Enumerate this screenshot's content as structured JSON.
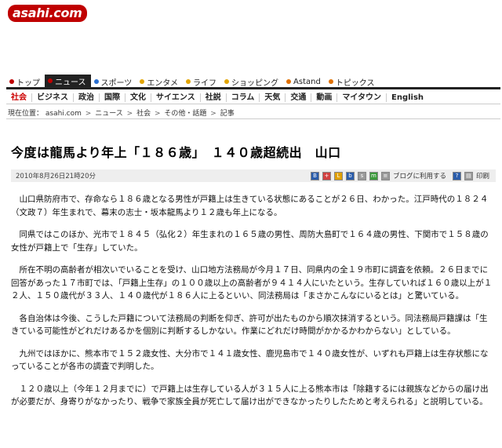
{
  "brand": {
    "logo": "asahi.com"
  },
  "nav_primary": [
    {
      "label": "トップ",
      "color": "#c00000"
    },
    {
      "label": "ニュース",
      "color": "#c00000",
      "active": true
    },
    {
      "label": "スポーツ",
      "color": "#2a6fd1"
    },
    {
      "label": "エンタメ",
      "color": "#e2a400"
    },
    {
      "label": "ライフ",
      "color": "#e2a400"
    },
    {
      "label": "ショッピング",
      "color": "#e2a400"
    },
    {
      "label": "Astand",
      "color": "#e07000"
    },
    {
      "label": "トピックス",
      "color": "#e07000"
    }
  ],
  "nav_secondary": [
    {
      "label": "社会",
      "active": true
    },
    {
      "label": "ビジネス"
    },
    {
      "label": "政治"
    },
    {
      "label": "国際"
    },
    {
      "label": "文化"
    },
    {
      "label": "サイエンス"
    },
    {
      "label": "社説"
    },
    {
      "label": "コラム"
    },
    {
      "label": "天気"
    },
    {
      "label": "交通"
    },
    {
      "label": "動画"
    },
    {
      "label": "マイタウン"
    },
    {
      "label": "English"
    }
  ],
  "breadcrumb": {
    "prefix": "現在位置：",
    "items": [
      "asahi.com",
      "ニュース",
      "社会",
      "その他・話題",
      "記事"
    ],
    "separator": ">"
  },
  "article": {
    "title": "今度は龍馬より年上「１８６歳」　１４０歳超続出　山口",
    "date": "2010年8月26日21時20分",
    "tools": {
      "blog_label": "ブログに利用する",
      "print_label": "印刷"
    },
    "paragraphs": [
      "山口県防府市で、存命なら１８６歳となる男性が戸籍上は生きている状態にあることが２６日、わかった。江戸時代の１８２４（文政７）年生まれで、幕末の志士・坂本龍馬より１２歳も年上になる。",
      "同県ではこのほか、光市で１８４５（弘化２）年生まれの１６５歳の男性、周防大島町で１６４歳の男性、下関市で１５８歳の女性が戸籍上で「生存」していた。",
      "所在不明の高齢者が相次いでいることを受け、山口地方法務局が今月１７日、同県内の全１９市町に調査を依頼。２６日までに回答があった１７市町では、「戸籍上生存」の１００歳以上の高齢者が９４１４人にいたという。生存していれば１６０歳以上が１２人、１５０歳代が３３人、１４０歳代が１８６人に上るといい、同法務局は「まさかこんなにいるとは」と驚いている。",
      "各自治体は今後、こうした戸籍について法務局の判断を仰ぎ、許可が出たものから順次抹消するという。同法務局戸籍課は「生きている可能性がどれだけあるかを個別に判断するしかない。作業にどれだけ時間がかかるかわからない」としている。",
      "九州ではほかに、熊本市で１５２歳女性、大分市で１４１歳女性、鹿児島市で１４０歳女性が、いずれも戸籍上は生存状態になっていることが各市の調査で判明した。",
      "１２０歳以上（今年１２月までに）で戸籍上は生存している人が３１５人に上る熊本市は「除籍するには親族などからの届け出が必要だが、身寄りがなかったり、戦争で家族全員が死亡して届け出ができなかったりしたためと考えられる」と説明している。"
    ]
  }
}
